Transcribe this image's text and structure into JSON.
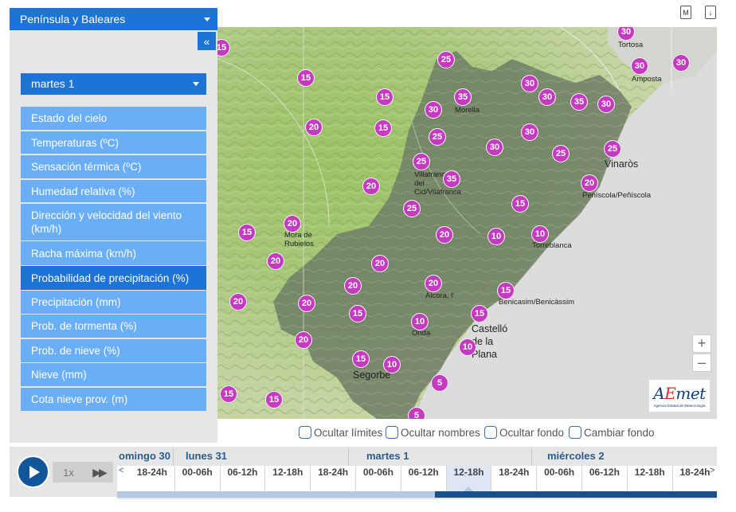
{
  "sidebar": {
    "region": "Península y Baleares",
    "collapse": "«",
    "day": "martes 1",
    "menu": [
      {
        "label": "Estado del cielo"
      },
      {
        "label": "Temperaturas (ºC)"
      },
      {
        "label": "Sensación térmica (ºC)"
      },
      {
        "label": "Humedad relativa (%)"
      },
      {
        "label": "Dirección y velocidad del viento (km/h)"
      },
      {
        "label": "Racha máxima (km/h)"
      },
      {
        "label": "Probabilidad de precipitación (%)",
        "active": true
      },
      {
        "label": "Precipitación (mm)"
      },
      {
        "label": "Prob. de tormenta (%)"
      },
      {
        "label": "Prob. de nieve (%)"
      },
      {
        "label": "Nieve (mm)"
      },
      {
        "label": "Cota nieve prov. (m)"
      }
    ]
  },
  "topbar": {
    "icon1": "M",
    "icon2": "↓"
  },
  "map": {
    "zoom_in": "+",
    "zoom_out": "–",
    "logo_brand_a": "A",
    "logo_brand_b": "E",
    "logo_brand_c": "met",
    "logo_sub": "Agencia Estatal de Meteorología",
    "cities": [
      {
        "name": "Tortosa"
      },
      {
        "name": "Amposta"
      },
      {
        "name": "Morella"
      },
      {
        "name": "Vinaròs"
      },
      {
        "name": "Villafranca\ndel\nCid/Vilafranca"
      },
      {
        "name": "Peníscola/Peñíscola"
      },
      {
        "name": "Mora de\nRubielos"
      },
      {
        "name": "Torreblanca"
      },
      {
        "name": "Alcora, l'"
      },
      {
        "name": "Benicasim/Benicàssim"
      },
      {
        "name": "Onda"
      },
      {
        "name": "Castelló\nde la\nPlana"
      },
      {
        "name": "Segorbe"
      }
    ],
    "markers": [
      {
        "v": "30"
      },
      {
        "v": "30"
      },
      {
        "v": "30"
      },
      {
        "v": "25"
      },
      {
        "v": "15"
      },
      {
        "v": "15"
      },
      {
        "v": "35"
      },
      {
        "v": "30"
      },
      {
        "v": "30"
      },
      {
        "v": "35"
      },
      {
        "v": "30"
      },
      {
        "v": "15"
      },
      {
        "v": "20"
      },
      {
        "v": "15"
      },
      {
        "v": "30"
      },
      {
        "v": "25"
      },
      {
        "v": "30"
      },
      {
        "v": "30"
      },
      {
        "v": "25"
      },
      {
        "v": "25"
      },
      {
        "v": "25"
      },
      {
        "v": "35"
      },
      {
        "v": "20"
      },
      {
        "v": "20"
      },
      {
        "v": "25"
      },
      {
        "v": "15"
      },
      {
        "v": "20"
      },
      {
        "v": "15"
      },
      {
        "v": "20"
      },
      {
        "v": "10"
      },
      {
        "v": "10"
      },
      {
        "v": "20"
      },
      {
        "v": "20"
      },
      {
        "v": "20"
      },
      {
        "v": "20"
      },
      {
        "v": "15"
      },
      {
        "v": "20"
      },
      {
        "v": "20"
      },
      {
        "v": "15"
      },
      {
        "v": "15"
      },
      {
        "v": "10"
      },
      {
        "v": "20"
      },
      {
        "v": "10"
      },
      {
        "v": "15"
      },
      {
        "v": "10"
      },
      {
        "v": "5"
      },
      {
        "v": "15"
      },
      {
        "v": "15"
      },
      {
        "v": "5"
      }
    ]
  },
  "toggles": [
    {
      "label": "Ocultar límites"
    },
    {
      "label": "Ocultar nombres"
    },
    {
      "label": "Ocultar fondo"
    },
    {
      "label": "Cambiar fondo"
    }
  ],
  "player": {
    "speed": "1x",
    "ff": "▶▶"
  },
  "timeline": {
    "days": [
      "omingo 30",
      "lunes 31",
      "martes 1",
      "miércoles 2"
    ],
    "slots": [
      "18-24h",
      "00-06h",
      "06-12h",
      "12-18h",
      "18-24h",
      "00-06h",
      "06-12h",
      "12-18h",
      "18-24h",
      "00-06h",
      "06-12h",
      "12-18h",
      "18-24h"
    ],
    "active_slot_index": 7,
    "left_arrow": "<",
    "right_arrow": ">"
  },
  "colors": {
    "primary": "#1e73d6",
    "menu": "#6aaef7",
    "marker": "#c53bc0",
    "region_shade": "#6f7d66"
  }
}
